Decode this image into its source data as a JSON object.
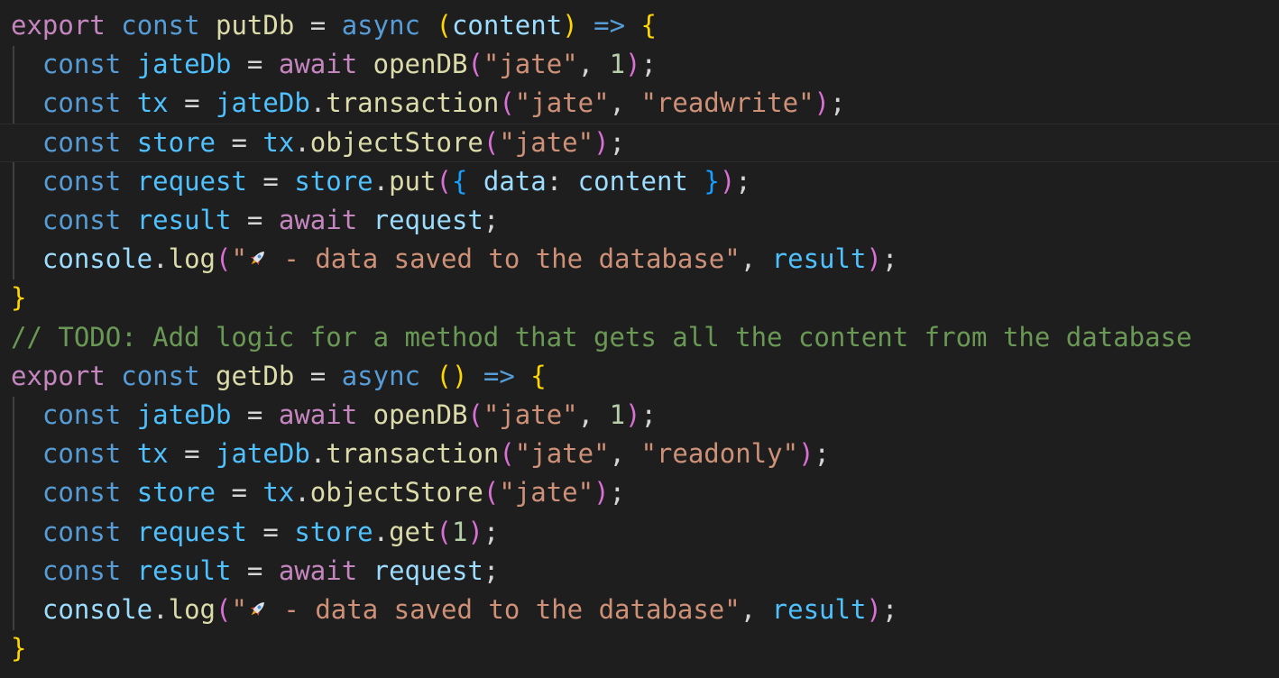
{
  "editor": {
    "indent": "  ",
    "kw_export": "export",
    "kw_const": "const",
    "kw_async": "async",
    "kw_await": "await",
    "op_assign": " = ",
    "arrow": " => ",
    "comment": "// TODO: Add logic for a method that gets all the content from the database",
    "rocket_icon": "rocket-icon",
    "put_function": {
      "name": "putDb",
      "param": "content",
      "db_name": "\"jate\"",
      "version": "1",
      "mode": "\"readwrite\"",
      "call": "put",
      "data_key": "data",
      "data_value": "content",
      "log_message": " - data saved to the database\""
    },
    "get_function": {
      "name": "getDb",
      "db_name": "\"jate\"",
      "version": "1",
      "mode": "\"readonly\"",
      "call": "get",
      "get_arg": "1",
      "log_message": " - data saved to the database\""
    },
    "identifiers": {
      "jateDb": "jateDb",
      "tx": "tx",
      "store": "store",
      "request": "request",
      "result": "result",
      "openDB": "openDB",
      "transaction": "transaction",
      "objectStore": "objectStore",
      "console": "console",
      "log": "log"
    }
  }
}
